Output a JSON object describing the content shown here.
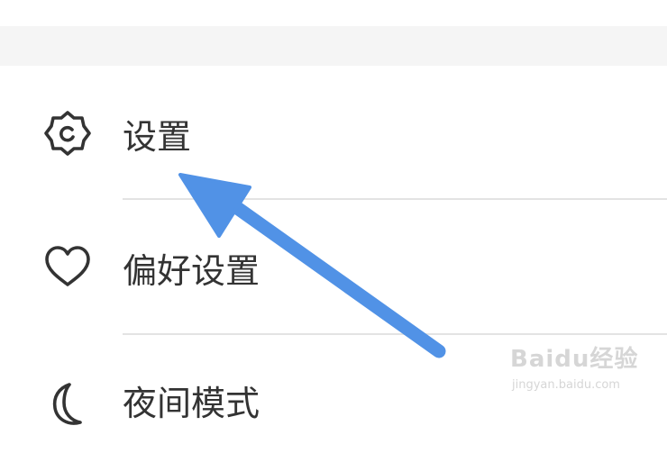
{
  "menu": {
    "items": [
      {
        "label": "设置",
        "icon": "gear-icon"
      },
      {
        "label": "偏好设置",
        "icon": "heart-icon"
      },
      {
        "label": "夜间模式",
        "icon": "moon-icon"
      }
    ]
  },
  "annotation": {
    "arrow_color": "#5192e6"
  },
  "watermark": {
    "text": "Baidu经验",
    "subtext": "jingyan.baidu.com"
  }
}
